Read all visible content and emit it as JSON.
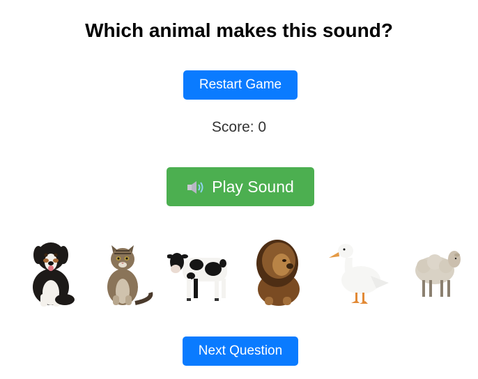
{
  "game": {
    "title": "Which animal makes this sound?",
    "restart_label": "Restart Game",
    "score_label": "Score: 0",
    "play_label": "Play Sound",
    "next_label": "Next Question"
  },
  "animals": [
    {
      "name": "dog"
    },
    {
      "name": "cat"
    },
    {
      "name": "cow"
    },
    {
      "name": "lion"
    },
    {
      "name": "duck"
    },
    {
      "name": "sheep"
    }
  ],
  "colors": {
    "blue_button": "#0a7bff",
    "green_button": "#4caf50"
  }
}
